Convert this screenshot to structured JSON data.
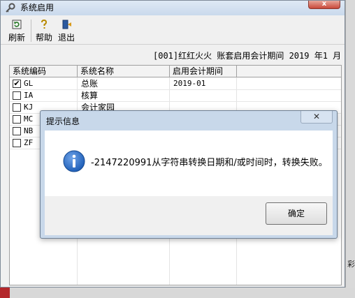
{
  "window": {
    "title": "系统启用",
    "close_glyph": "x"
  },
  "toolbar": {
    "refresh_label": "刷新",
    "help_label": "帮助",
    "exit_label": "退出"
  },
  "period_info": "[001]红红火火 账套启用会计期间 2019 年1 月",
  "table": {
    "headers": [
      "系统编码",
      "系统名称",
      "启用会计期间"
    ],
    "rows": [
      {
        "checked": true,
        "code": "GL",
        "name": "总账",
        "date": "2019-01"
      },
      {
        "checked": false,
        "code": "IA",
        "name": "核算",
        "date": ""
      },
      {
        "checked": false,
        "code": "KJ",
        "name": "会计家园",
        "date": ""
      },
      {
        "checked": false,
        "code": "MC",
        "name": "",
        "date": ""
      },
      {
        "checked": false,
        "code": "NB",
        "name": "",
        "date": ""
      },
      {
        "checked": false,
        "code": "ZF",
        "name": "",
        "date": ""
      }
    ]
  },
  "dialog": {
    "title": "提示信息",
    "close_glyph": "✕",
    "icon": "info-icon",
    "message": "-2147220991从字符串转换日期和/或时间时，转换失败。",
    "ok_label": "确定"
  },
  "background": {
    "fragment_text": "彩"
  },
  "colors": {
    "title_gradient_top": "#dfe9f5",
    "dialog_frame": "#c8d8ea",
    "close_red": "#c9483a",
    "info_blue": "#1f5fb8"
  }
}
